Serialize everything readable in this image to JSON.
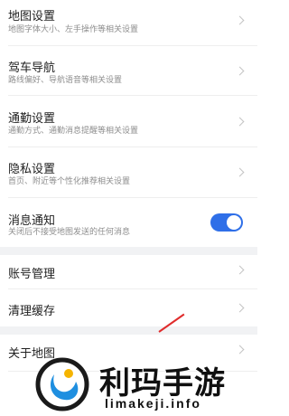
{
  "settings": {
    "map_settings": {
      "title": "地图设置",
      "subtitle": "地图字体大小、左手操作等相关设置"
    },
    "driving_nav": {
      "title": "驾车导航",
      "subtitle": "路线偏好、导航语音等相关设置"
    },
    "commute": {
      "title": "通勤设置",
      "subtitle": "通勤方式、通勤消息提醒等相关设置"
    },
    "privacy": {
      "title": "隐私设置",
      "subtitle": "首页、附近等个性化推荐相关设置"
    },
    "notifications": {
      "title": "消息通知",
      "subtitle": "关闭后不接受地图发送的任何消息",
      "enabled": true
    },
    "account": {
      "title": "账号管理"
    },
    "cache": {
      "title": "清理缓存"
    },
    "about": {
      "title": "关于地图"
    }
  },
  "watermark": {
    "name": "利玛手游",
    "domain": "limakeji.info"
  },
  "colors": {
    "toggle_on": "#2f6fe8",
    "watermark_arrow": "#e02c2c",
    "section_gap": "#f1f2f4"
  }
}
